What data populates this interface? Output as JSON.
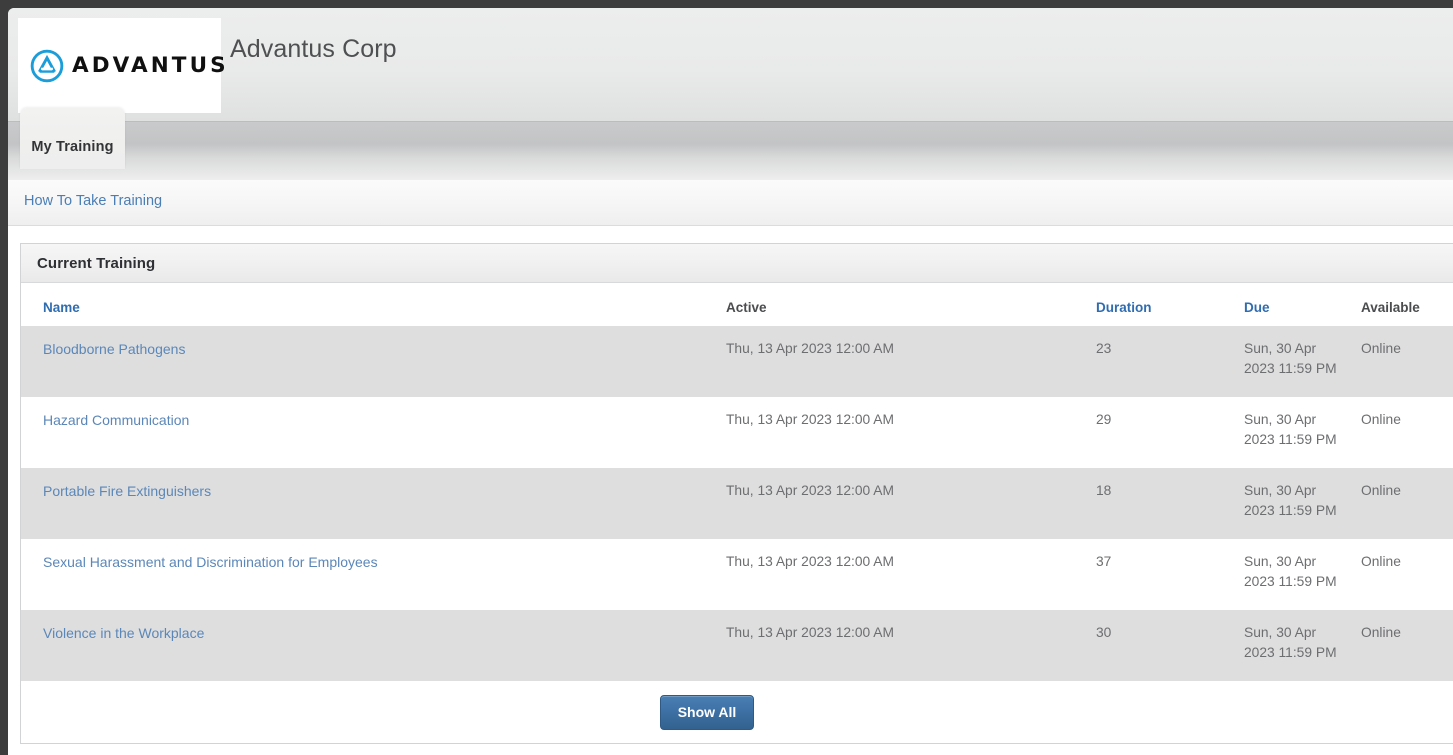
{
  "header": {
    "logo_word": "ADVANTUS",
    "logo_icon": "advantus-circle-a-logo",
    "org_title": "Advantus Corp",
    "brand_blue": "#1b9dd9"
  },
  "tabs": [
    {
      "label": "My Training",
      "active": true
    }
  ],
  "breadcrumb": {
    "link_label": "How To Take Training"
  },
  "panel": {
    "title": "Current Training",
    "columns": [
      {
        "label": "Name",
        "is_link": true
      },
      {
        "label": "Active",
        "is_link": false
      },
      {
        "label": "Duration",
        "is_link": true
      },
      {
        "label": "Due",
        "is_link": true
      },
      {
        "label": "Available",
        "is_link": false
      }
    ],
    "rows": [
      {
        "name": "Bloodborne Pathogens",
        "active": "Thu, 13 Apr 2023 12:00 AM",
        "duration": "23",
        "due": "Sun, 30 Apr 2023 11:59 PM",
        "available": "Online"
      },
      {
        "name": "Hazard Communication",
        "active": "Thu, 13 Apr 2023 12:00 AM",
        "duration": "29",
        "due": "Sun, 30 Apr 2023 11:59 PM",
        "available": "Online"
      },
      {
        "name": "Portable Fire Extinguishers",
        "active": "Thu, 13 Apr 2023 12:00 AM",
        "duration": "18",
        "due": "Sun, 30 Apr 2023 11:59 PM",
        "available": "Online"
      },
      {
        "name": "Sexual Harassment and Discrimination for Employees",
        "active": "Thu, 13 Apr 2023 12:00 AM",
        "duration": "37",
        "due": "Sun, 30 Apr 2023 11:59 PM",
        "available": "Online"
      },
      {
        "name": "Violence in the Workplace",
        "active": "Thu, 13 Apr 2023 12:00 AM",
        "duration": "30",
        "due": "Sun, 30 Apr 2023 11:59 PM",
        "available": "Online"
      }
    ],
    "show_all_label": "Show All"
  }
}
